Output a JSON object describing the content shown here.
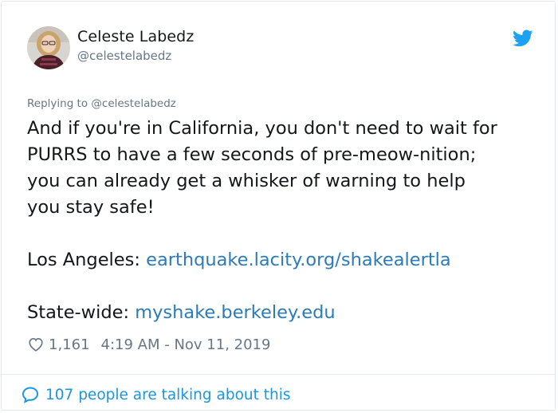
{
  "author": {
    "display_name": "Celeste Labedz",
    "handle": "@celestelabedz"
  },
  "reply": {
    "text": "Replying to @celestelabedz"
  },
  "tweet": {
    "line1": "And if you're in California, you don't need to wait for",
    "line2": "PURRS to have a few seconds of pre-meow-nition;",
    "line3": "you can already get a whisker of warning to help",
    "line4": "you stay safe!",
    "la_label": "Los Angeles:",
    "la_link": "earthquake.lacity.org/shakealertla",
    "state_label": "State-wide:",
    "state_link": "myshake.berkeley.edu"
  },
  "stats": {
    "likes": "1,161",
    "timestamp": "4:19 AM - Nov 11, 2019"
  },
  "footer": {
    "conversation": "107 people are talking about this"
  },
  "colors": {
    "link": "#2b7bb9",
    "brand": "#1da1f2",
    "secondary_text": "#657786",
    "border": "#e1e8ed"
  },
  "icons": {
    "brand": "twitter-bird-icon",
    "like": "heart-icon",
    "conversation": "speech-bubble-icon"
  }
}
